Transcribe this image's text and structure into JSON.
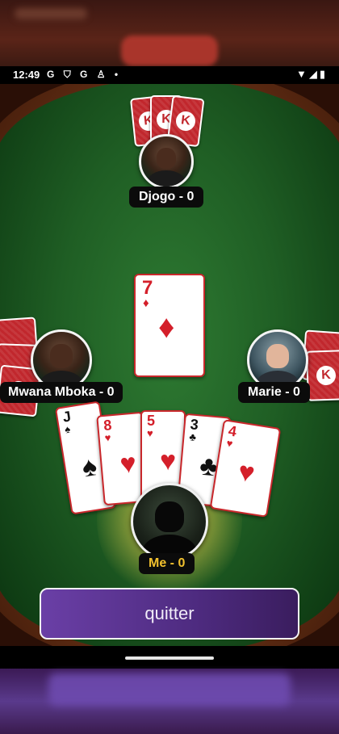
{
  "status_bar": {
    "time": "12:49",
    "left_icons": [
      "G",
      "shield-icon",
      "G",
      "accessibility-icon",
      "•"
    ],
    "right_icons": [
      "wifi-icon",
      "signal-icon",
      "battery-icon"
    ]
  },
  "players": {
    "top": {
      "name_label": "Djogo - 0"
    },
    "left": {
      "name_label": "Mwana Mboka - 0"
    },
    "right": {
      "name_label": "Marie - 0"
    },
    "me": {
      "name_label": "Me - 0"
    }
  },
  "card_back_mark": "K",
  "played_card": {
    "rank": "7",
    "suit": "♦",
    "color": "red"
  },
  "hand": [
    {
      "rank": "J",
      "suit": "♠",
      "color": "black"
    },
    {
      "rank": "8",
      "suit": "♥",
      "color": "red"
    },
    {
      "rank": "5",
      "suit": "♥",
      "color": "red"
    },
    {
      "rank": "3",
      "suit": "♣",
      "color": "black"
    },
    {
      "rank": "4",
      "suit": "♥",
      "color": "red"
    }
  ],
  "quit_button": {
    "label": "quitter"
  },
  "colors": {
    "felt": "#1f5e24",
    "card_back": "#c1272d",
    "me_label": "#f2c12e",
    "quit_button": "#5a3490"
  }
}
